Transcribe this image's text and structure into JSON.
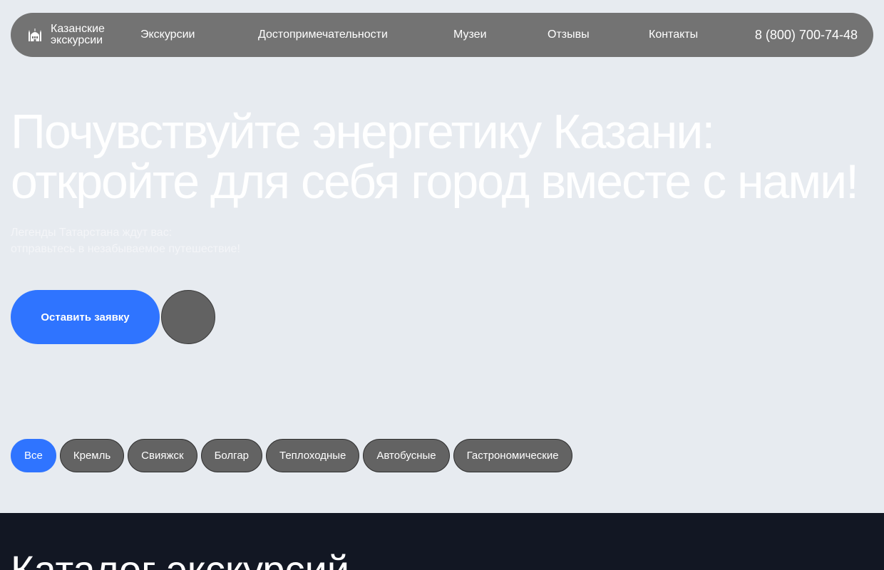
{
  "header": {
    "logo_icon": "mosque-icon",
    "logo_line1": "Казанские",
    "logo_line2": "экскурсии",
    "nav": {
      "excursions": "Экскурсии",
      "sights": "Достопримечательности",
      "museums": "Музеи",
      "reviews": "Отзывы",
      "contacts": "Контакты"
    },
    "phone": "8 (800) 700-74-48"
  },
  "hero": {
    "title_line1": "Почувствуйте энергетику Казани:",
    "title_line2": "откройте для себя город вместе с нами!",
    "subtitle_line1": "Легенды Татарстана ждут вас:",
    "subtitle_line2": "отправьтесь в незабываемое путешествие!",
    "cta_label": "Оставить заявку"
  },
  "filters": [
    {
      "label": "Все",
      "active": true
    },
    {
      "label": "Кремль",
      "active": false
    },
    {
      "label": "Свияжск",
      "active": false
    },
    {
      "label": "Болгар",
      "active": false
    },
    {
      "label": "Теплоходные",
      "active": false
    },
    {
      "label": "Автобусные",
      "active": false
    },
    {
      "label": "Гастрономические",
      "active": false
    }
  ],
  "catalog": {
    "title": "Каталог экскурсий"
  },
  "colors": {
    "page_bg": "#e7ebf0",
    "nav_bg": "#737373",
    "accent": "#2f74ff",
    "pill_bg": "#636363",
    "dark_section": "#121723"
  }
}
